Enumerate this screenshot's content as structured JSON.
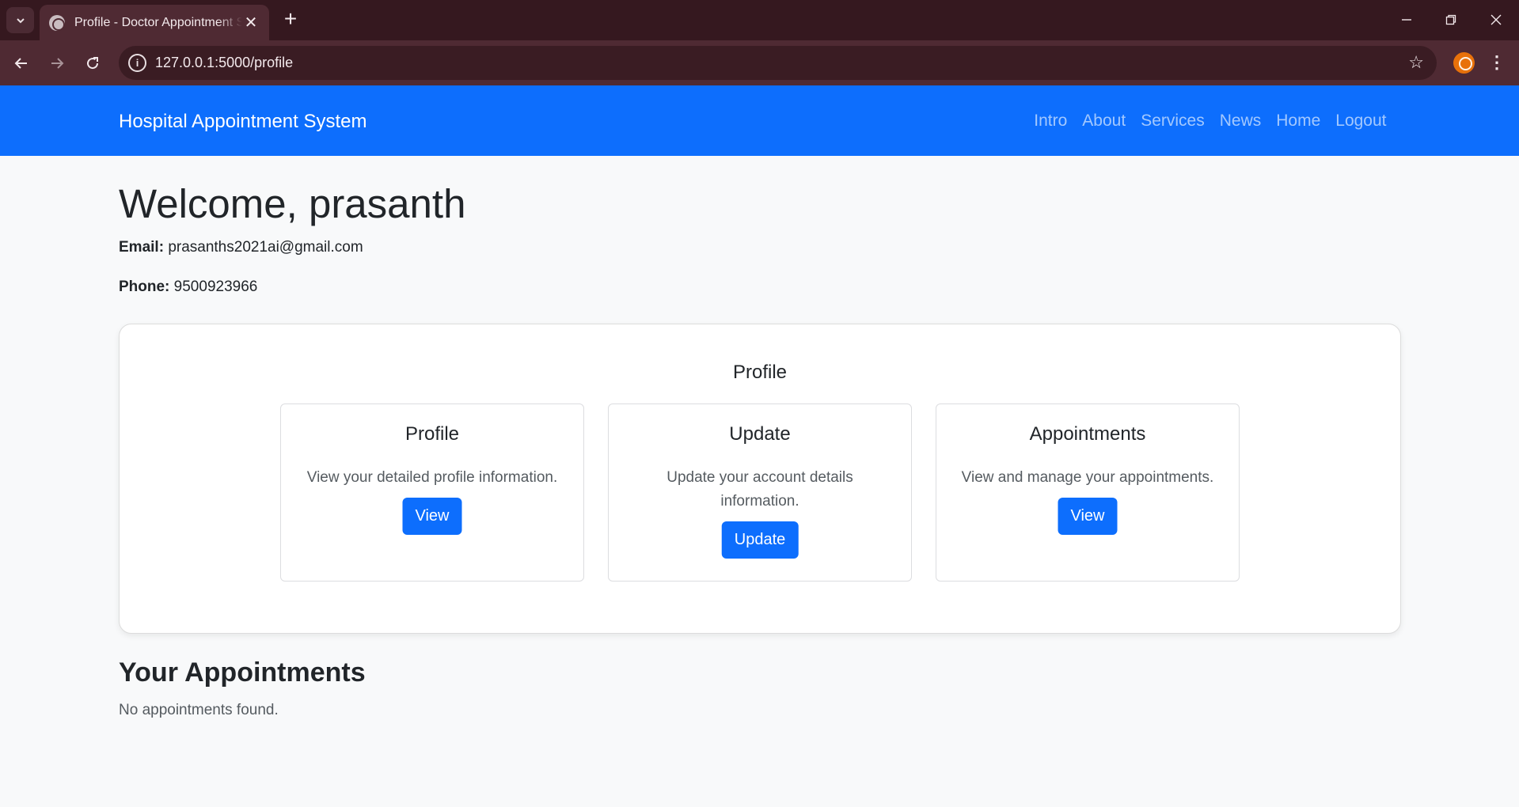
{
  "browser": {
    "tab_title": "Profile - Doctor Appointment System",
    "url": "127.0.0.1:5000/profile"
  },
  "navbar": {
    "brand": "Hospital Appointment System",
    "links": [
      "Intro",
      "About",
      "Services",
      "News",
      "Home",
      "Logout"
    ]
  },
  "user": {
    "welcome": "Welcome, prasanth",
    "email_label": "Email:",
    "email": "prasanths2021ai@gmail.com",
    "phone_label": "Phone:",
    "phone": "9500923966"
  },
  "profile_section": {
    "heading": "Profile",
    "cards": [
      {
        "title": "Profile",
        "text": "View your detailed profile information.",
        "button": "View"
      },
      {
        "title": "Update",
        "text": "Update your account details information.",
        "button": "Update"
      },
      {
        "title": "Appointments",
        "text": "View and manage your appointments.",
        "button": "View"
      }
    ]
  },
  "appointments": {
    "heading": "Your Appointments",
    "empty_text": "No appointments found."
  },
  "colors": {
    "primary": "#0d6efd",
    "chrome_dark": "#35181f",
    "chrome_toolbar": "#4f2a33",
    "page_bg": "#f8f9fa"
  }
}
